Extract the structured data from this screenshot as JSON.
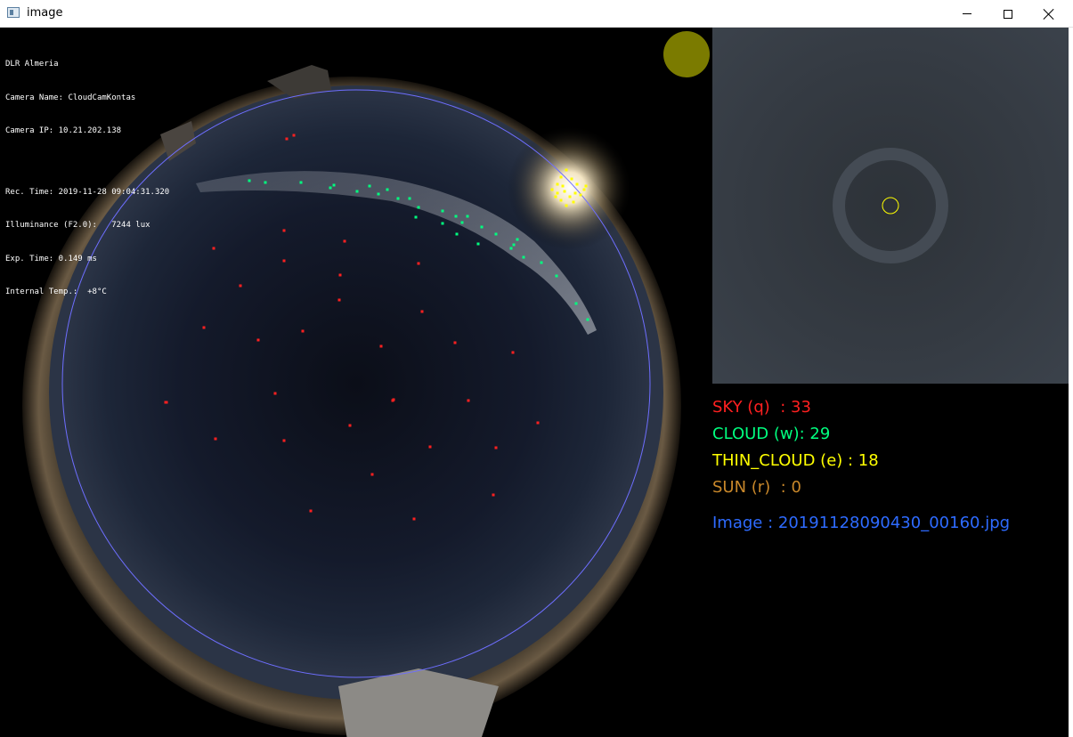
{
  "window": {
    "title": "image",
    "icon": "app-window-icon",
    "controls": {
      "minimize": "minimize-icon",
      "maximize": "maximize-icon",
      "close": "close-icon"
    }
  },
  "overlay": {
    "lines_a": [
      "DLR Almeria",
      "Camera Name: CloudCamKontas",
      "Camera IP: 10.21.202.138"
    ],
    "lines_b": [
      "Rec. Time: 2019-11-28 09:04:31.320",
      "Illuminance (F2.0):   7244 lux",
      "Exp. Time: 0.149 ms",
      "Internal Temp.:  +8°C"
    ]
  },
  "legend": {
    "sky": {
      "text": "SKY (q)  : 33",
      "color": "#ff2020"
    },
    "cloud": {
      "text": "CLOUD (w): 29",
      "color": "#00ff7f"
    },
    "thin_cloud": {
      "text": "THIN_CLOUD (e) : 18",
      "color": "#ffff00"
    },
    "sun": {
      "text": "SUN (r)  : 0",
      "color": "#c8872a"
    },
    "image": {
      "text": "Image : 20191128090430_00160.jpg",
      "color": "#2e6bff"
    }
  },
  "colors": {
    "circle": "#6e6eff",
    "sun_indicator": "#7b7b00",
    "zoom_marker": "#ffff00"
  }
}
